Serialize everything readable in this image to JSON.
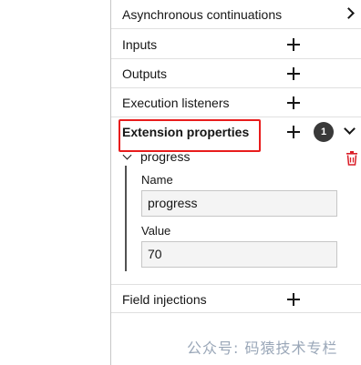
{
  "groups": {
    "async": {
      "title": "Asynchronous continuations",
      "icon": "chevron-right-icon"
    },
    "inputs": {
      "title": "Inputs",
      "icon": "plus-icon"
    },
    "outputs": {
      "title": "Outputs",
      "icon": "plus-icon"
    },
    "execution_listeners": {
      "title": "Execution listeners",
      "icon": "plus-icon"
    },
    "extension_properties": {
      "title": "Extension properties",
      "count": "1",
      "icon": "plus-icon",
      "expanded": true
    },
    "field_injections": {
      "title": "Field injections",
      "icon": "plus-icon"
    }
  },
  "extension_entry": {
    "title": "progress",
    "name_label": "Name",
    "name_value": "progress",
    "value_label": "Value",
    "value_value": "70"
  },
  "colors": {
    "highlight": "#e81c1c",
    "delete": "#da1e28",
    "badge": "#393939"
  },
  "watermark": "公众号: 码猿技术专栏"
}
